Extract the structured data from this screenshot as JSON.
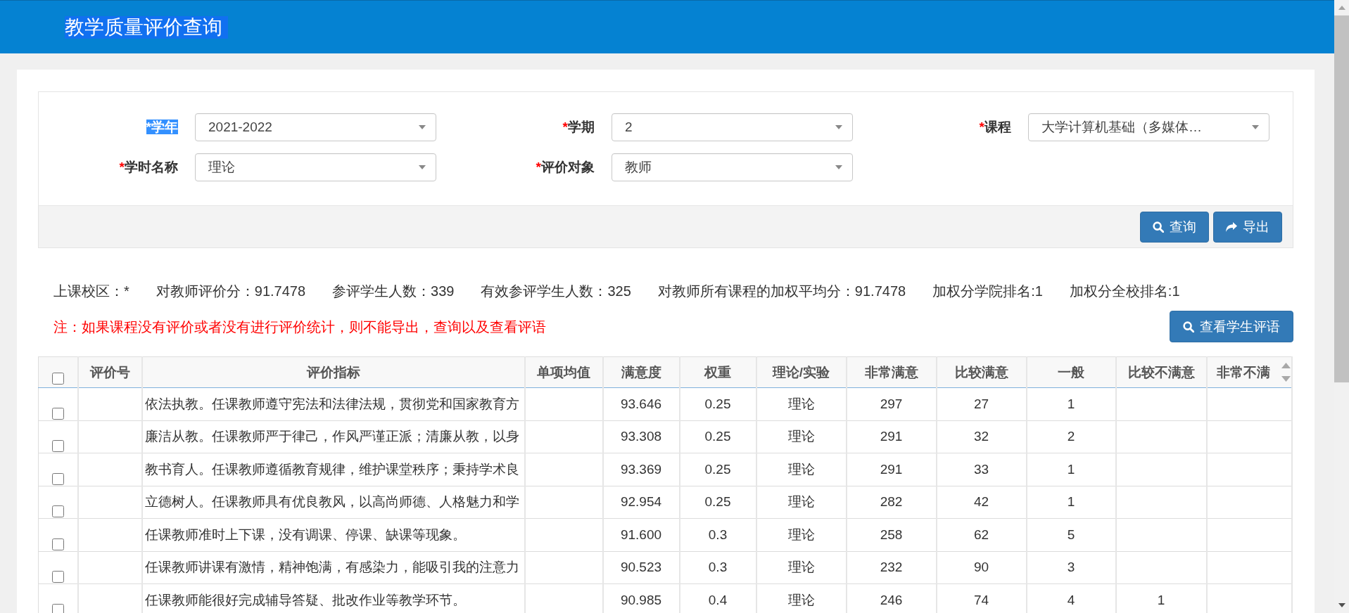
{
  "header": {
    "title": "教学质量评价查询",
    "highlighted": true
  },
  "filters": [
    {
      "mark": "*",
      "label": "学年",
      "value": "2021-2022",
      "highlighted": true
    },
    {
      "mark": "*",
      "label": "学期",
      "value": "2",
      "highlighted": false
    },
    {
      "mark": "*",
      "label": "课程",
      "value": "大学计算机基础（多媒体…",
      "highlighted": false
    },
    {
      "mark": "*",
      "label": "学时名称",
      "value": "理论",
      "highlighted": false
    },
    {
      "mark": "*",
      "label": "评价对象",
      "value": "教师",
      "highlighted": false
    }
  ],
  "actions": [
    {
      "kind": "query",
      "label": "查询"
    },
    {
      "kind": "export",
      "label": "导出"
    }
  ],
  "summary": [
    "上课校区：*",
    "对教师评价分：91.7478",
    "参评学生人数：339",
    "有效参评学生人数：325",
    "对教师所有课程的加权平均分：91.7478",
    "加权分学院排名:1",
    "加权分全校排名:1"
  ],
  "notice": "注：如果课程没有评价或者没有进行评价统计，则不能导出，查询以及查看评语",
  "comments_button": {
    "label": "查看学生评语"
  },
  "table": {
    "select_all": {
      "checked": false
    },
    "columns": [
      "评价号",
      "评价指标",
      "单项均值",
      "满意度",
      "权重",
      "理论/实验",
      "非常满意",
      "比较满意",
      "一般",
      "比较不满意",
      "非常不满"
    ],
    "rows": [
      {
        "checked": false,
        "cells": [
          null,
          "依法执教。任课教师遵守宪法和法律法规，贯彻党和国家教育方",
          null,
          "93.646",
          "0.25",
          "理论",
          "297",
          "27",
          "1",
          null,
          null
        ]
      },
      {
        "checked": false,
        "cells": [
          null,
          "廉洁从教。任课教师严于律己，作风严谨正派；清廉从教，以身",
          null,
          "93.308",
          "0.25",
          "理论",
          "291",
          "32",
          "2",
          null,
          null
        ]
      },
      {
        "checked": false,
        "cells": [
          null,
          "教书育人。任课教师遵循教育规律，维护课堂秩序；秉持学术良",
          null,
          "93.369",
          "0.25",
          "理论",
          "291",
          "33",
          "1",
          null,
          null
        ]
      },
      {
        "checked": false,
        "cells": [
          null,
          "立德树人。任课教师具有优良教风，以高尚师德、人格魅力和学",
          null,
          "92.954",
          "0.25",
          "理论",
          "282",
          "42",
          "1",
          null,
          null
        ]
      },
      {
        "checked": false,
        "cells": [
          null,
          "任课教师准时上下课，没有调课、停课、缺课等现象。",
          null,
          "91.600",
          "0.3",
          "理论",
          "258",
          "62",
          "5",
          null,
          null
        ]
      },
      {
        "checked": false,
        "cells": [
          null,
          "任课教师讲课有激情，精神饱满，有感染力，能吸引我的注意力",
          null,
          "90.523",
          "0.3",
          "理论",
          "232",
          "90",
          "3",
          null,
          null
        ]
      },
      {
        "checked": false,
        "cells": [
          null,
          "任课教师能很好完成辅导答疑、批改作业等教学环节。",
          null,
          "90.985",
          "0.4",
          "理论",
          "246",
          "74",
          "4",
          "1",
          null
        ]
      }
    ]
  }
}
